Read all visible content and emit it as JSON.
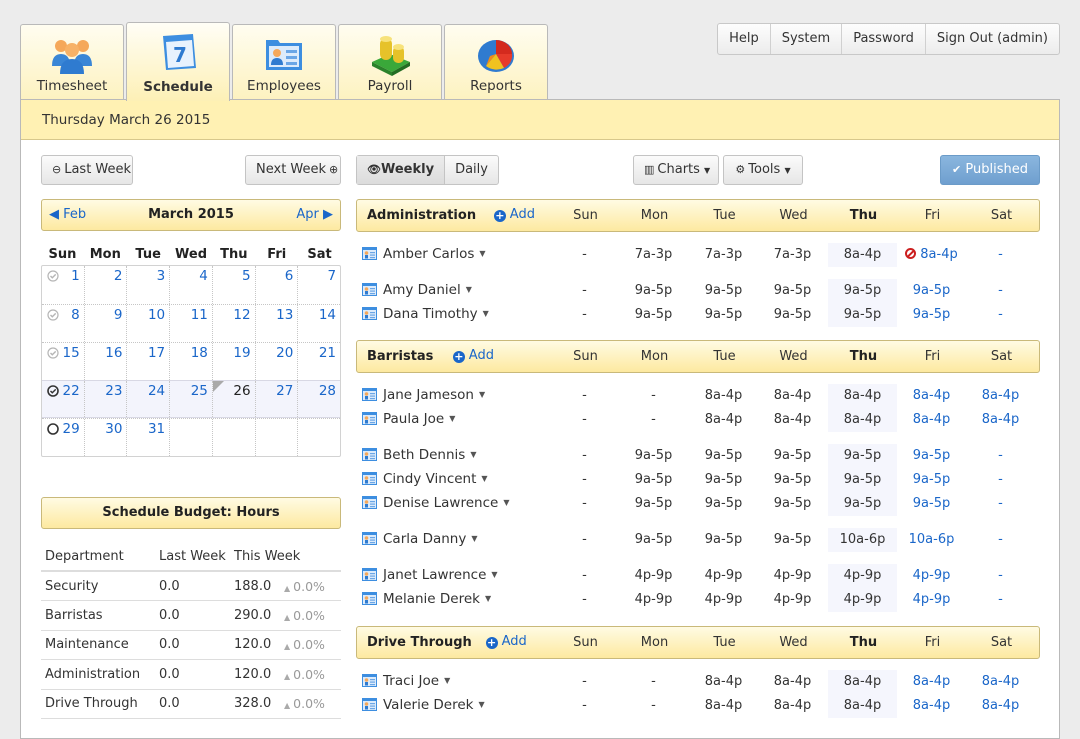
{
  "tabs": [
    {
      "label": "Timesheet",
      "icon": "people-icon",
      "active": false
    },
    {
      "label": "Schedule",
      "icon": "calendar-icon",
      "active": true
    },
    {
      "label": "Employees",
      "icon": "employee-card-icon",
      "active": false
    },
    {
      "label": "Payroll",
      "icon": "coins-icon",
      "active": false
    },
    {
      "label": "Reports",
      "icon": "pie-chart-icon",
      "active": false
    }
  ],
  "top_nav": {
    "help": "Help",
    "system": "System",
    "password": "Password",
    "sign_out": "Sign Out (admin)"
  },
  "date_bar": "Thursday March 26 2015",
  "week_nav": {
    "last_week": "Last Week",
    "next_week": "Next Week"
  },
  "calendar": {
    "title": "March 2015",
    "prev": "Feb",
    "next": "Apr",
    "dow": [
      "Sun",
      "Mon",
      "Tue",
      "Wed",
      "Thu",
      "Fri",
      "Sat"
    ],
    "weeks": [
      {
        "status": "published-past",
        "days": [
          "1",
          "2",
          "3",
          "4",
          "5",
          "6",
          "7"
        ]
      },
      {
        "status": "published-past",
        "days": [
          "8",
          "9",
          "10",
          "11",
          "12",
          "13",
          "14"
        ]
      },
      {
        "status": "published-past",
        "days": [
          "15",
          "16",
          "17",
          "18",
          "19",
          "20",
          "21"
        ]
      },
      {
        "status": "published-current",
        "days": [
          "22",
          "23",
          "24",
          "25",
          "26",
          "27",
          "28"
        ]
      },
      {
        "status": "unpublished",
        "days": [
          "29",
          "30",
          "31",
          "",
          "",
          "",
          ""
        ]
      }
    ],
    "today": "26"
  },
  "budget": {
    "title": "Schedule Budget: Hours",
    "headers": [
      "Department",
      "Last Week",
      "This Week"
    ],
    "rows": [
      {
        "dept": "Security",
        "last": "0.0",
        "this": "188.0",
        "change": "0.0%"
      },
      {
        "dept": "Barristas",
        "last": "0.0",
        "this": "290.0",
        "change": "0.0%"
      },
      {
        "dept": "Maintenance",
        "last": "0.0",
        "this": "120.0",
        "change": "0.0%"
      },
      {
        "dept": "Administration",
        "last": "0.0",
        "this": "120.0",
        "change": "0.0%"
      },
      {
        "dept": "Drive Through",
        "last": "0.0",
        "this": "328.0",
        "change": "0.0%"
      }
    ]
  },
  "toolbar": {
    "weekly": "Weekly",
    "daily": "Daily",
    "charts": "Charts",
    "tools": "Tools",
    "published": "Published"
  },
  "schedule": {
    "days": [
      "Sun",
      "Mon",
      "Tue",
      "Wed",
      "Thu",
      "Fri",
      "Sat"
    ],
    "add_label": "Add",
    "departments": [
      {
        "name": "Administration",
        "employees": [
          {
            "name": "Amber Carlos",
            "shifts": [
              "-",
              "7a-3p",
              "7a-3p",
              "7a-3p",
              "8a-4p",
              "8a-4p",
              "-"
            ],
            "fri_unavailable": true
          },
          {
            "name": "Amy Daniel",
            "shifts": [
              "-",
              "9a-5p",
              "9a-5p",
              "9a-5p",
              "9a-5p",
              "9a-5p",
              "-"
            ],
            "gap": true
          },
          {
            "name": "Dana Timothy",
            "shifts": [
              "-",
              "9a-5p",
              "9a-5p",
              "9a-5p",
              "9a-5p",
              "9a-5p",
              "-"
            ]
          }
        ]
      },
      {
        "name": "Barristas",
        "employees": [
          {
            "name": "Jane Jameson",
            "shifts": [
              "-",
              "-",
              "8a-4p",
              "8a-4p",
              "8a-4p",
              "8a-4p",
              "8a-4p"
            ]
          },
          {
            "name": "Paula Joe",
            "shifts": [
              "-",
              "-",
              "8a-4p",
              "8a-4p",
              "8a-4p",
              "8a-4p",
              "8a-4p"
            ]
          },
          {
            "name": "Beth Dennis",
            "shifts": [
              "-",
              "9a-5p",
              "9a-5p",
              "9a-5p",
              "9a-5p",
              "9a-5p",
              "-"
            ],
            "gap": true
          },
          {
            "name": "Cindy Vincent",
            "shifts": [
              "-",
              "9a-5p",
              "9a-5p",
              "9a-5p",
              "9a-5p",
              "9a-5p",
              "-"
            ]
          },
          {
            "name": "Denise Lawrence",
            "shifts": [
              "-",
              "9a-5p",
              "9a-5p",
              "9a-5p",
              "9a-5p",
              "9a-5p",
              "-"
            ]
          },
          {
            "name": "Carla Danny",
            "shifts": [
              "-",
              "9a-5p",
              "9a-5p",
              "9a-5p",
              "10a-6p",
              "10a-6p",
              "-"
            ],
            "gap": true
          },
          {
            "name": "Janet Lawrence",
            "shifts": [
              "-",
              "4p-9p",
              "4p-9p",
              "4p-9p",
              "4p-9p",
              "4p-9p",
              "-"
            ],
            "gap": true
          },
          {
            "name": "Melanie Derek",
            "shifts": [
              "-",
              "4p-9p",
              "4p-9p",
              "4p-9p",
              "4p-9p",
              "4p-9p",
              "-"
            ]
          }
        ]
      },
      {
        "name": "Drive Through",
        "employees": [
          {
            "name": "Traci Joe",
            "shifts": [
              "-",
              "-",
              "8a-4p",
              "8a-4p",
              "8a-4p",
              "8a-4p",
              "8a-4p"
            ]
          },
          {
            "name": "Valerie Derek",
            "shifts": [
              "-",
              "-",
              "8a-4p",
              "8a-4p",
              "8a-4p",
              "8a-4p",
              "8a-4p"
            ]
          }
        ]
      }
    ]
  }
}
